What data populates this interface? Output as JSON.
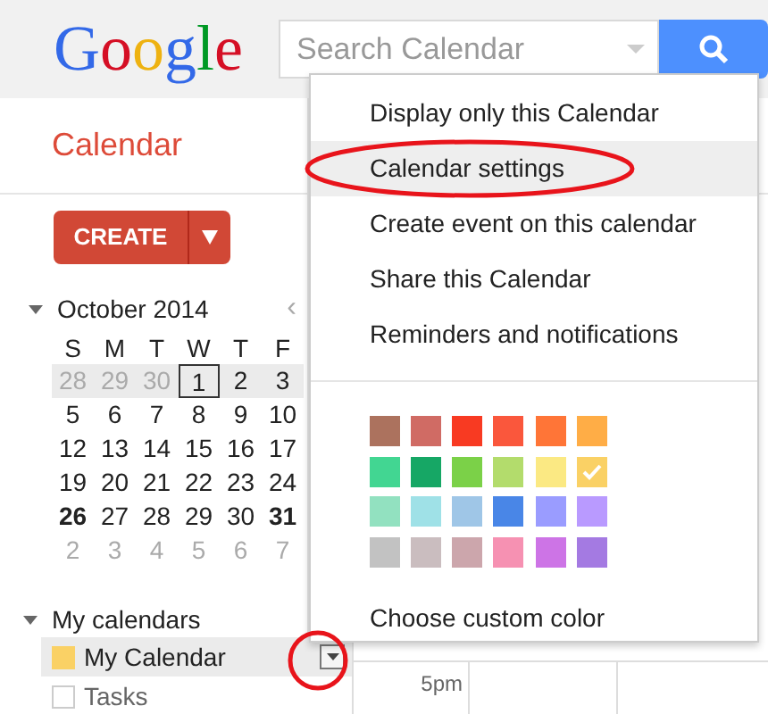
{
  "header": {
    "logo": "Google",
    "search": {
      "placeholder": "Search Calendar"
    }
  },
  "sidebar": {
    "title": "Calendar",
    "create_button": "CREATE",
    "mini_calendar": {
      "month": "October 2014",
      "prev": "‹",
      "weekdays": [
        "S",
        "M",
        "T",
        "W",
        "T",
        "F"
      ],
      "weeks": [
        {
          "selected": true,
          "days": [
            {
              "d": "28",
              "muted": true,
              "today": false,
              "bold": false
            },
            {
              "d": "29",
              "muted": true,
              "today": false,
              "bold": false
            },
            {
              "d": "30",
              "muted": true,
              "today": false,
              "bold": false
            },
            {
              "d": "1",
              "muted": false,
              "today": true,
              "bold": false
            },
            {
              "d": "2",
              "muted": false,
              "today": false,
              "bold": false
            },
            {
              "d": "3",
              "muted": false,
              "today": false,
              "bold": false
            }
          ]
        },
        {
          "selected": false,
          "days": [
            {
              "d": "5",
              "muted": false,
              "today": false,
              "bold": false
            },
            {
              "d": "6",
              "muted": false,
              "today": false,
              "bold": false
            },
            {
              "d": "7",
              "muted": false,
              "today": false,
              "bold": false
            },
            {
              "d": "8",
              "muted": false,
              "today": false,
              "bold": false
            },
            {
              "d": "9",
              "muted": false,
              "today": false,
              "bold": false
            },
            {
              "d": "10",
              "muted": false,
              "today": false,
              "bold": false
            }
          ]
        },
        {
          "selected": false,
          "days": [
            {
              "d": "12",
              "muted": false,
              "today": false,
              "bold": false
            },
            {
              "d": "13",
              "muted": false,
              "today": false,
              "bold": false
            },
            {
              "d": "14",
              "muted": false,
              "today": false,
              "bold": false
            },
            {
              "d": "15",
              "muted": false,
              "today": false,
              "bold": false
            },
            {
              "d": "16",
              "muted": false,
              "today": false,
              "bold": false
            },
            {
              "d": "17",
              "muted": false,
              "today": false,
              "bold": false
            }
          ]
        },
        {
          "selected": false,
          "days": [
            {
              "d": "19",
              "muted": false,
              "today": false,
              "bold": false
            },
            {
              "d": "20",
              "muted": false,
              "today": false,
              "bold": false
            },
            {
              "d": "21",
              "muted": false,
              "today": false,
              "bold": false
            },
            {
              "d": "22",
              "muted": false,
              "today": false,
              "bold": false
            },
            {
              "d": "23",
              "muted": false,
              "today": false,
              "bold": false
            },
            {
              "d": "24",
              "muted": false,
              "today": false,
              "bold": false
            }
          ]
        },
        {
          "selected": false,
          "days": [
            {
              "d": "26",
              "muted": false,
              "today": false,
              "bold": true
            },
            {
              "d": "27",
              "muted": false,
              "today": false,
              "bold": false
            },
            {
              "d": "28",
              "muted": false,
              "today": false,
              "bold": false
            },
            {
              "d": "29",
              "muted": false,
              "today": false,
              "bold": false
            },
            {
              "d": "30",
              "muted": false,
              "today": false,
              "bold": false
            },
            {
              "d": "31",
              "muted": false,
              "today": false,
              "bold": true
            }
          ]
        },
        {
          "selected": false,
          "days": [
            {
              "d": "2",
              "muted": true,
              "today": false,
              "bold": false
            },
            {
              "d": "3",
              "muted": true,
              "today": false,
              "bold": false
            },
            {
              "d": "4",
              "muted": true,
              "today": false,
              "bold": false
            },
            {
              "d": "5",
              "muted": true,
              "today": false,
              "bold": false
            },
            {
              "d": "6",
              "muted": true,
              "today": false,
              "bold": false
            },
            {
              "d": "7",
              "muted": true,
              "today": false,
              "bold": false
            }
          ]
        }
      ]
    },
    "my_calendars": {
      "title": "My calendars",
      "items": [
        {
          "name": "My Calendar",
          "color": "#fad165",
          "checked": true,
          "selected": true
        },
        {
          "name": "Tasks",
          "checked": false,
          "selected": false
        }
      ]
    }
  },
  "main": {
    "time_label": "5pm"
  },
  "menu": {
    "items": [
      {
        "label": "Display only this Calendar",
        "selected": false
      },
      {
        "label": "Calendar settings",
        "selected": true
      },
      {
        "label": "Create event on this calendar",
        "selected": false
      },
      {
        "label": "Share this Calendar",
        "selected": false
      },
      {
        "label": "Reminders and notifications",
        "selected": false
      }
    ],
    "colors": [
      {
        "color": "#ac725e",
        "selected": false
      },
      {
        "color": "#d06b64",
        "selected": false
      },
      {
        "color": "#f83a22",
        "selected": false
      },
      {
        "color": "#fa573c",
        "selected": false
      },
      {
        "color": "#ff7537",
        "selected": false
      },
      {
        "color": "#ffad46",
        "selected": false
      },
      {
        "color": "#42d692",
        "selected": false
      },
      {
        "color": "#16a765",
        "selected": false
      },
      {
        "color": "#7bd148",
        "selected": false
      },
      {
        "color": "#b3dc6c",
        "selected": false
      },
      {
        "color": "#fbe983",
        "selected": false
      },
      {
        "color": "#fad165",
        "selected": true
      },
      {
        "color": "#92e1c0",
        "selected": false
      },
      {
        "color": "#9fe1e7",
        "selected": false
      },
      {
        "color": "#9fc6e7",
        "selected": false
      },
      {
        "color": "#4986e7",
        "selected": false
      },
      {
        "color": "#9a9cff",
        "selected": false
      },
      {
        "color": "#b99aff",
        "selected": false
      },
      {
        "color": "#c2c2c2",
        "selected": false
      },
      {
        "color": "#cabdbf",
        "selected": false
      },
      {
        "color": "#cca6ac",
        "selected": false
      },
      {
        "color": "#f691b2",
        "selected": false
      },
      {
        "color": "#cd74e6",
        "selected": false
      },
      {
        "color": "#a47ae2",
        "selected": false
      }
    ],
    "custom_color": "Choose custom color"
  }
}
